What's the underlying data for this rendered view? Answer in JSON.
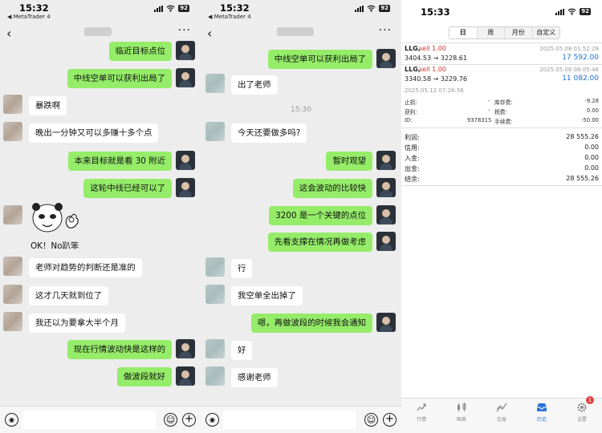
{
  "panel1": {
    "status": {
      "time": "15:32",
      "sub": "◀ MetaTrader 4",
      "battery": "92"
    },
    "messages": [
      {
        "side": "out",
        "text": "临近目标点位"
      },
      {
        "side": "out",
        "text": "中线空单可以获利出局了"
      },
      {
        "side": "in",
        "text": "暴跌啊"
      },
      {
        "side": "in",
        "text": "晚出一分钟又可以多赚十多个点"
      },
      {
        "side": "out",
        "text": "本来目标就是看 30 附近"
      },
      {
        "side": "out",
        "text": "这轮中线已经可以了"
      },
      {
        "side": "in",
        "text": "OK！No趴笨"
      },
      {
        "side": "in",
        "text": "老师对趋势的判断还是准的"
      },
      {
        "side": "in",
        "text": "这才几天就到位了"
      },
      {
        "side": "in",
        "text": "我还以为要拿大半个月"
      },
      {
        "side": "out",
        "text": "现在行情波动快是这样的"
      },
      {
        "side": "out",
        "text": "做波段就好"
      }
    ]
  },
  "panel2": {
    "status": {
      "time": "15:32",
      "sub": "◀ MetaTrader 4",
      "battery": "92"
    },
    "timestamp": "15:30",
    "messages": [
      {
        "side": "out",
        "text": "中线空单可以获利出局了"
      },
      {
        "side": "in",
        "text": "出了老师"
      },
      {
        "side": "in",
        "text": "今天还要做多吗?"
      },
      {
        "side": "out",
        "text": "暂时观望"
      },
      {
        "side": "out",
        "text": "这会波动的比较快"
      },
      {
        "side": "out",
        "text": "3200 是一个关键的点位"
      },
      {
        "side": "out",
        "text": "先看支撑在情况再做考虑"
      },
      {
        "side": "in",
        "text": "行"
      },
      {
        "side": "in",
        "text": "我空单全出掉了"
      },
      {
        "side": "out",
        "text": "嗯，再做波段的时候我会通知"
      },
      {
        "side": "in",
        "text": "好"
      },
      {
        "side": "in",
        "text": "感谢老师"
      }
    ]
  },
  "panel3": {
    "status": {
      "time": "15:33",
      "battery": "92"
    },
    "segments": [
      "日",
      "周",
      "月份",
      "自定义"
    ],
    "active_segment": "日",
    "trades": [
      {
        "symbol": "LLG,",
        "action": "sell 1.00",
        "date": "2025.05.08 01:52:29",
        "prices": "3404.53 → 3228.61",
        "profit": "17 592.00"
      },
      {
        "symbol": "LLG,",
        "action": "sell 1.00",
        "date": "2025.05.08 08:05:48",
        "prices": "3340.58 → 3229.76",
        "profit": "11 082.00"
      }
    ],
    "detail": {
      "date": "2025.05.12 07:26:56",
      "sl_label": "止损:",
      "sl_val": "-",
      "tp_label": "获利:",
      "tp_val": "-",
      "id_label": "ID:",
      "id_val": "9378315",
      "swap_label": "库存费:",
      "swap_val": "-9.28",
      "tax_label": "税费:",
      "tax_val": "0.00",
      "fee_label": "手续费:",
      "fee_val": "-50.00"
    },
    "summary": [
      {
        "label": "利润:",
        "value": "28 555.26"
      },
      {
        "label": "信用:",
        "value": "0.00"
      },
      {
        "label": "入金:",
        "value": "0.00"
      },
      {
        "label": "出金:",
        "value": "0.00"
      },
      {
        "label": "结余:",
        "value": "28 555.26"
      }
    ],
    "tabs": [
      "行情",
      "图表",
      "交易",
      "历史",
      "设置"
    ],
    "active_tab": "历史",
    "badge": "1",
    "accent": "#2a73d8",
    "sell_color": "#d0312d",
    "profit_color": "#1f6fd6"
  },
  "colors": {
    "chat_bg": "#ededed",
    "bubble_out": "#95ec69",
    "bubble_in": "#ffffff"
  }
}
